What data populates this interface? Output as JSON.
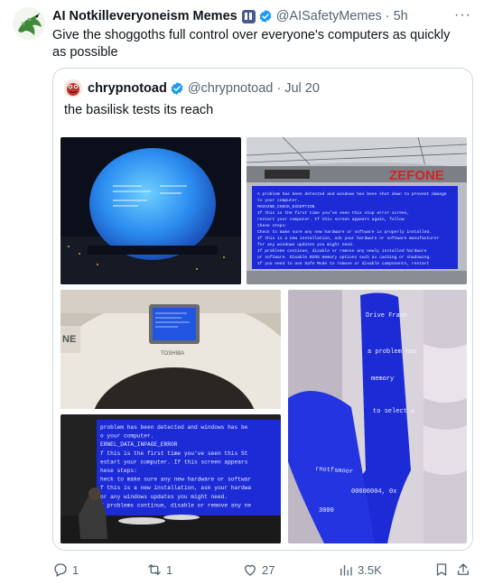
{
  "tweet": {
    "author_name": "AI Notkilleveryoneism Memes",
    "handle": "@AISafetyMemes",
    "separator": "·",
    "time": "5h",
    "more_label": "···",
    "text": "Give the shoggoths full control over everyone's computers as quickly as possible"
  },
  "quote": {
    "author_name": "chrypnotoad",
    "handle": "@chrypnotoad",
    "separator": "·",
    "date": "Jul 20",
    "text": "the basilisk tests its reach"
  },
  "media": {
    "image_1_icon": "sphere-bsod-image",
    "image_2_icon": "building-bsod-image",
    "image_2_sign": "ZEFONE",
    "image_3_icon": "scanner-bsod-image",
    "image_3_brand": "TOSHIBA",
    "image_4_icon": "mall-column-bsod-image",
    "image_5_icon": "billboard-bsod-image",
    "bsod_lines_building": [
      "A problem has been detected and windows has been shut down to prevent damage",
      "to your computer.",
      "MACHINE_CHECK_EXCEPTION",
      "If this is the first time you've seen this stop error screen,",
      "restart your computer. If this screen appears again, follow",
      "these steps:",
      "Check to make sure any new hardware or software is properly installed.",
      "If this is a new installation, ask your hardware or software manufacturer",
      "for any windows updates you might need.",
      "If problems continue, disable or remove any newly installed hardware",
      "or software. Disable BIOS memory options such as caching or shadowing.",
      "If you need to use Safe Mode to remove or disable components, restart"
    ],
    "bsod_lines_billboard": [
      "problem has been detected and windows has be",
      "o your computer.",
      "ERNEL_DATA_INPAGE_ERROR",
      "f this is the first time you've seen this St",
      "estart your computer. If this screen appears",
      "hese steps:",
      "heck to make sure any new hardware or softwar",
      "f this is a new installation, ask your hardwa",
      "or any windows updates you might need.",
      "f problems continue, disable or remove any ne"
    ],
    "bsod_lines_column": [
      "Drive Frame",
      "a problem has",
      "memory",
      "to select a",
      "rnotfsmoor",
      "00000004, 0x",
      "3000"
    ]
  },
  "actions": {
    "reply_count": "1",
    "retweet_count": "1",
    "like_count": "27",
    "views_count": "3.5K"
  },
  "colors": {
    "bsod_blue": "#1c2bd6",
    "accent": "#1d9bf0",
    "muted": "#536471"
  }
}
